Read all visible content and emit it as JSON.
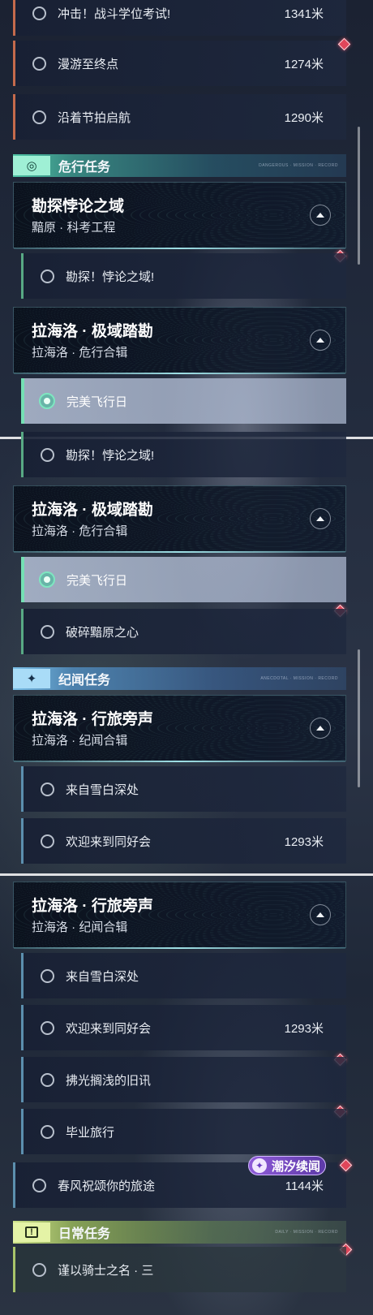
{
  "quests": {
    "top_rows": [
      {
        "label": "冲击！战斗学位考试!",
        "distance": "1341米"
      },
      {
        "label": "漫游至终点",
        "distance": "1274米"
      },
      {
        "label": "沿着节拍启航",
        "distance": "1290米"
      }
    ],
    "danger": {
      "header": "危行任务",
      "fine_print": "DANGEROUS · MISSION · RECORD",
      "group1": {
        "title": "勘探悖论之域",
        "subtitle": "黯原 · 科考工程"
      },
      "group1_rows": [
        {
          "label": "勘探！悖论之域!"
        }
      ],
      "group2": {
        "title": "拉海洛 · 极域踏勘",
        "subtitle": "拉海洛 · 危行合辑"
      },
      "group2_rows": [
        {
          "label": "完美飞行日",
          "selected": true
        }
      ]
    },
    "danger2": {
      "rows_top": [
        {
          "label": "勘探！悖论之域!"
        }
      ],
      "group": {
        "title": "拉海洛 · 极域踏勘",
        "subtitle": "拉海洛 · 危行合辑"
      },
      "rows": [
        {
          "label": "完美飞行日",
          "selected": true
        },
        {
          "label": "破碎黯原之心"
        }
      ]
    },
    "lore": {
      "header": "纪闻任务",
      "fine_print": "ANECDOTAL · MISSION · RECORD",
      "group": {
        "title": "拉海洛 · 行旅旁声",
        "subtitle": "拉海洛 · 纪闻合辑"
      },
      "rows": [
        {
          "label": "来自雪白深处"
        },
        {
          "label": "欢迎来到同好会",
          "distance": "1293米"
        }
      ]
    },
    "lore2": {
      "group": {
        "title": "拉海洛 · 行旅旁声",
        "subtitle": "拉海洛 · 纪闻合辑"
      },
      "rows": [
        {
          "label": "来自雪白深处"
        },
        {
          "label": "欢迎来到同好会",
          "distance": "1293米"
        },
        {
          "label": "拂光搁浅的旧讯"
        },
        {
          "label": "毕业旅行"
        }
      ],
      "standalone": {
        "label": "春风祝颂你的旅途",
        "distance": "1144米"
      },
      "badge": "潮汐续闻"
    },
    "daily": {
      "header": "日常任务",
      "fine_print": "DAILY · MISSION · RECORD",
      "rows": [
        {
          "label": "谨以骑士之名 · 三"
        }
      ]
    }
  },
  "colors": {
    "danger_accent": "#4fc4a5",
    "lore_accent": "#7bc0e8",
    "daily_accent": "#cfe38a",
    "alert_diamond": "#e0465a"
  }
}
